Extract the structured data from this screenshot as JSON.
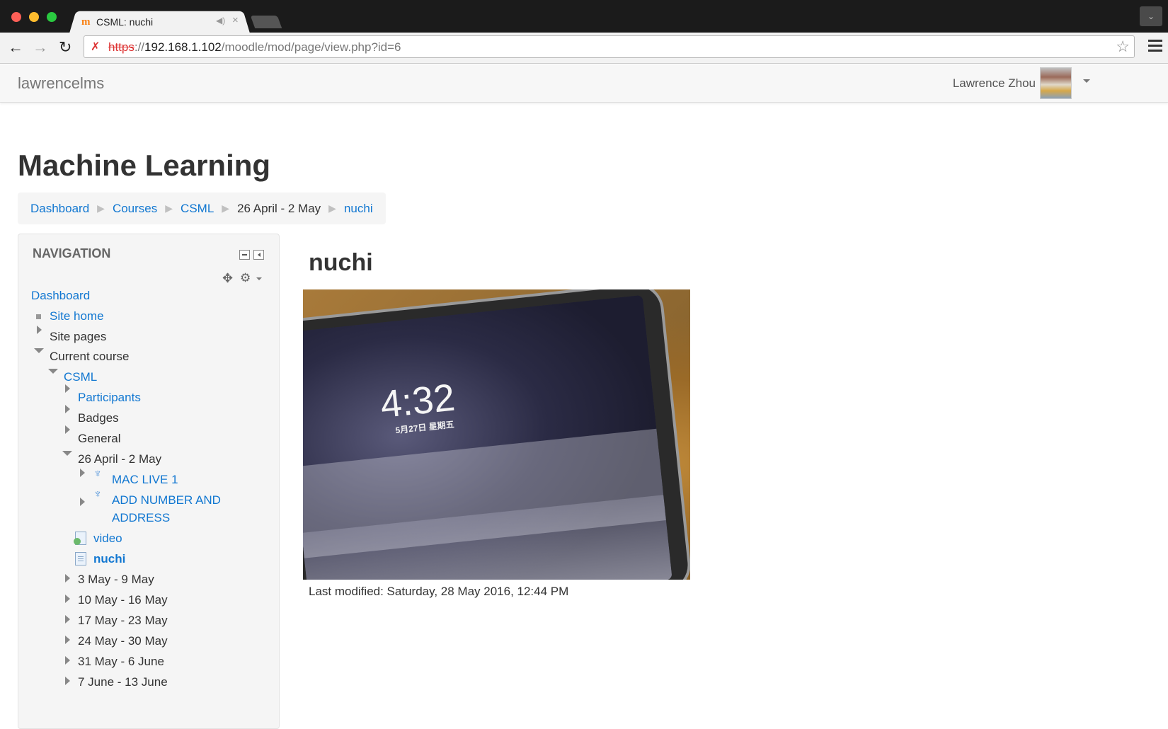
{
  "browser": {
    "tab_title": "CSML: nuchi",
    "url_scheme": "https",
    "url_sep": "://",
    "url_host": "192.168.1.102",
    "url_path": "/moodle/mod/page/view.php?id=6"
  },
  "header": {
    "brand": "lawrencelms",
    "user_name": "Lawrence Zhou"
  },
  "course_title": "Machine Learning",
  "breadcrumb": [
    "Dashboard",
    "Courses",
    "CSML",
    "26 April - 2 May",
    "nuchi"
  ],
  "navigation": {
    "heading": "NAVIGATION",
    "items": [
      {
        "label": "Dashboard"
      },
      {
        "label": "Site home"
      },
      {
        "label": "Site pages"
      },
      {
        "label": "Current course"
      },
      {
        "label": "CSML"
      },
      {
        "label": "Participants"
      },
      {
        "label": "Badges"
      },
      {
        "label": "General"
      },
      {
        "label": "26 April - 2 May"
      },
      {
        "label": "MAC LIVE 1"
      },
      {
        "label": "ADD NUMBER AND"
      },
      {
        "label": "ADDRESS"
      },
      {
        "label": "video"
      },
      {
        "label": "nuchi"
      },
      {
        "label": "3 May - 9 May"
      },
      {
        "label": "10 May - 16 May"
      },
      {
        "label": "17 May - 23 May"
      },
      {
        "label": "24 May - 30 May"
      },
      {
        "label": "31 May - 6 June"
      },
      {
        "label": "7 June - 13 June"
      }
    ]
  },
  "main": {
    "page_heading": "nuchi",
    "photo_time": "4:32",
    "photo_date": "5月27日 星期五",
    "last_modified": "Last modified: Saturday, 28 May 2016, 12:44 PM"
  }
}
